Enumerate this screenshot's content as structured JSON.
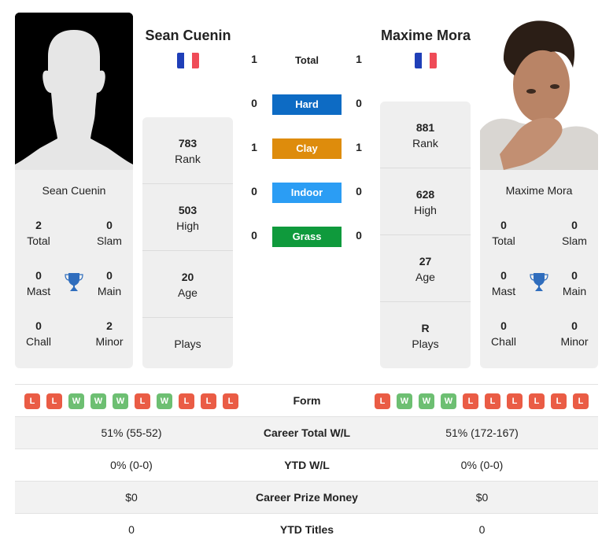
{
  "colors": {
    "hard": "#0d6bc4",
    "clay": "#de8c0c",
    "indoor": "#2b9df4",
    "grass": "#0f9a3c",
    "loss": "#ea5c45",
    "win": "#6dbf72",
    "trophy": "#2f6dbd",
    "flag_blue": "#1f3fb8",
    "flag_red": "#ef4b57"
  },
  "player1": {
    "name": "Sean Cuenin",
    "flag": "france-flag",
    "card_name": "Sean Cuenin",
    "titles": {
      "total": {
        "value": "2",
        "label": "Total"
      },
      "slam": {
        "value": "0",
        "label": "Slam"
      },
      "mast": {
        "value": "0",
        "label": "Mast"
      },
      "main": {
        "value": "0",
        "label": "Main"
      },
      "chall": {
        "value": "0",
        "label": "Chall"
      },
      "minor": {
        "value": "2",
        "label": "Minor"
      }
    },
    "stats": {
      "rank": {
        "value": "783",
        "label": "Rank"
      },
      "high": {
        "value": "503",
        "label": "High"
      },
      "age": {
        "value": "20",
        "label": "Age"
      },
      "plays": {
        "value": "",
        "label": "Plays"
      }
    },
    "form": [
      "L",
      "L",
      "W",
      "W",
      "W",
      "L",
      "W",
      "L",
      "L",
      "L"
    ]
  },
  "player2": {
    "name": "Maxime Mora",
    "flag": "france-flag",
    "card_name": "Maxime Mora",
    "titles": {
      "total": {
        "value": "0",
        "label": "Total"
      },
      "slam": {
        "value": "0",
        "label": "Slam"
      },
      "mast": {
        "value": "0",
        "label": "Mast"
      },
      "main": {
        "value": "0",
        "label": "Main"
      },
      "chall": {
        "value": "0",
        "label": "Chall"
      },
      "minor": {
        "value": "0",
        "label": "Minor"
      }
    },
    "stats": {
      "rank": {
        "value": "881",
        "label": "Rank"
      },
      "high": {
        "value": "628",
        "label": "High"
      },
      "age": {
        "value": "27",
        "label": "Age"
      },
      "plays": {
        "value": "R",
        "label": "Plays"
      }
    },
    "form": [
      "L",
      "W",
      "W",
      "W",
      "L",
      "L",
      "L",
      "L",
      "L",
      "L"
    ]
  },
  "h2h": {
    "total": {
      "label": "Total",
      "p1": "1",
      "p2": "1"
    },
    "hard": {
      "label": "Hard",
      "p1": "0",
      "p2": "0"
    },
    "clay": {
      "label": "Clay",
      "p1": "1",
      "p2": "1"
    },
    "indoor": {
      "label": "Indoor",
      "p1": "0",
      "p2": "0"
    },
    "grass": {
      "label": "Grass",
      "p1": "0",
      "p2": "0"
    }
  },
  "comparison": {
    "form_label": "Form",
    "rows": [
      {
        "label": "Career Total W/L",
        "p1": "51% (55-52)",
        "p2": "51% (172-167)"
      },
      {
        "label": "YTD W/L",
        "p1": "0% (0-0)",
        "p2": "0% (0-0)"
      },
      {
        "label": "Career Prize Money",
        "p1": "$0",
        "p2": "$0"
      },
      {
        "label": "YTD Titles",
        "p1": "0",
        "p2": "0"
      }
    ]
  }
}
